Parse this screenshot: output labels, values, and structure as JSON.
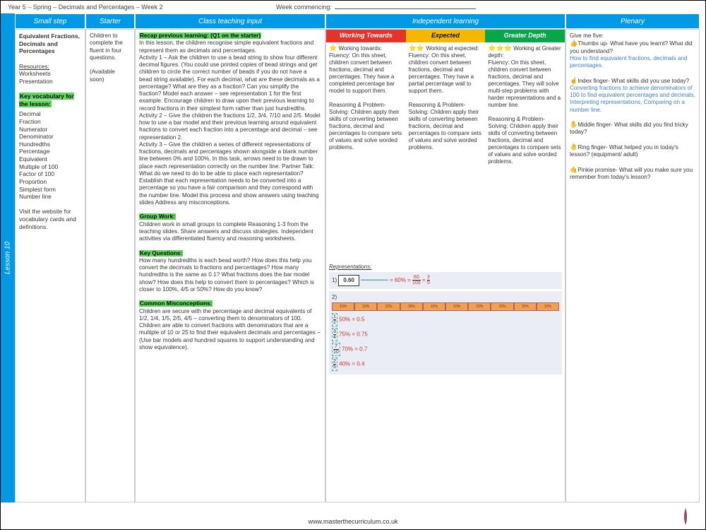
{
  "header": {
    "title": "Year 5 – Spring – Decimals and Percentages – Week 2",
    "week_label": "Week commencing:"
  },
  "lesson_tab": "Lesson 10",
  "columns": {
    "c1": "Small step",
    "c2": "Starter",
    "c3": "Class teaching input",
    "c4": "Independent learning",
    "c5": "Plenary"
  },
  "small_step": {
    "title": "Equivalent Fractions, Decimals and Percentages",
    "resources_h": "Resources:",
    "resources": "Worksheets\nPresentation",
    "vocab_h": "Key vocabulary for the lesson:",
    "vocab": "Decimal\nFraction\nNumerator\nDenominator\nHundredths\nPercentage\nEquivalent\nMultiple of 100\nFactor of 100\nProportion\nSimplest form\nNumber line",
    "visit": "Visit the website for vocabulary cards and definitions."
  },
  "starter": {
    "p1": "Children to complete the fluent in four questions.",
    "p2": "(Available soon)"
  },
  "teaching": {
    "recap_h": "Recap previous learning: (Q1 on the starter)",
    "recap": "In this lesson, the children recognise simple equivalent fractions and represent them as decimals and percentages.\nActivity 1 – Ask the children to use a bead string to show four different decimal figures. (You could use printed copies of bead strings and get children to circle the correct number of beads if you do not have a bead string available). For each decimal, what are these decimals as a percentage? What are they as a fraction? Can you simplify the fraction? Model each answer – see representation 1 for the first example. Encourage children to draw upon their previous learning to record fractions in their simplest form rather than just hundredths.\nActivity 2 – Give the children the fractions 1/2, 3/4, 7/10 and 2/5. Model how to use a bar model and their previous learning around equivalent fractions to convert each fraction into a percentage and decimal – see representation 2.\nActivity 3 – Give the children a series of different representations of fractions, decimals and percentages shown alongside a blank number line between 0% and 100%. In this task, arrows need to be drawn to place each representation correctly on the number line. Partner Talk: What do we need to do to be able to place each representation? Establish that each representation needs to be converted into a percentage so you have a fair comparison and they correspond with the number line. Model this process and show answers using teaching slides Address any misconceptions.",
    "group_h": "Group Work:",
    "group": "Children work in small groups to complete Reasoning 1-3 from the teaching slides. Share answers and discuss strategies. Independent activities via differentiated fluency and reasoning worksheets.",
    "kq_h": "Key Questions:",
    "kq": "How many hundredths is each bead worth? How does this help you convert the decimals to fractions and percentages? How many hundredths is the same as 0.1? What fractions does the bar model show? How does this help to convert them to percentages? Which is closer to 100%, 4/5 or 50%? How do you know?",
    "cm_h": "Common Misconceptions:",
    "cm": "Children are secure with the percentage and decimal equivalents of 1/2, 1/4, 1/5, 2/5, 4/5 – converting them to denominators of 100. Children are able to convert fractions with denominators that are a multiple of 10 or 25 to find their equivalent decimals and percentages – (Use bar models and hundred squares to support understanding and show equivalence)."
  },
  "indep": {
    "h_wt": "Working Towards",
    "h_ex": "Expected",
    "h_gd": "Greater Depth",
    "wt_title": "Working towards:",
    "wt": "Fluency: On this sheet, children convert between fractions, decimal and percentages. They have a completed percentage bar model to support them.\n\nReasoning & Problem-Solving: Children apply their skills of converting between fractions, decimal and percentages to compare sets of values and solve worded problems.",
    "ex_title": "Working at expected:",
    "ex": "Fluency: On this sheet, children convert between fractions, decimal and percentages. They have a partial percentage wall to support them.\n\nReasoning & Problem-Solving: Children apply their skills of converting between fractions, decimal and percentages to compare sets of values and solve worded problems.",
    "gd_title": "Working at Greater depth:",
    "gd": "Fluency: On this sheet, children convert between fractions, decimal and percentages. They will solve multi-step problems with harder representations and a number line.\n\nReasoning & Problem-Solving: Children apply their skills of converting between fractions, decimal and percentages to compare sets of values and solve worded problems."
  },
  "reps": {
    "title": "Representations:",
    "r1_label": "1)",
    "r1_val": "0.60",
    "r1_pct": "= 60% =",
    "r1_f1n": "60",
    "r1_f1d": "100",
    "r1_eq": "=",
    "r1_f2n": "3",
    "r1_f2d": "5",
    "r2_label": "2)",
    "r2_cell": "10%",
    "r2_a_n": "1",
    "r2_a_d": "2",
    "r2_a_t": "50% = 0.5",
    "r2_b_n": "3",
    "r2_b_d": "4",
    "r2_b_t": "75% = 0.75",
    "r2_c_n": "7",
    "r2_c_d": "10",
    "r2_c_t": "70% = 0.7",
    "r2_d_n": "2",
    "r2_d_d": "5",
    "r2_d_t": "40% = 0.4"
  },
  "plenary": {
    "intro": "Give me five:",
    "p1a": "Thumbs up- What have you learnt? What did you understand?",
    "p1b": "How to find equivalent fractions, decimals and percentages.",
    "p2a": "Index finger- What skills did you use today?",
    "p2b": "Converting fractions to achieve denominators of 100 to find equivalent percentages and decimals, Interpreting representations, Comparing on a number line.",
    "p3": "Middle finger- What skills did you find tricky today?",
    "p4": "Ring finger- What helped you in today's lesson? (equipment/ adult)",
    "p5": "Pinkie promise- What will you make sure you remember from today's lesson?"
  },
  "footer": "www.masterthecurriculum.co.uk"
}
